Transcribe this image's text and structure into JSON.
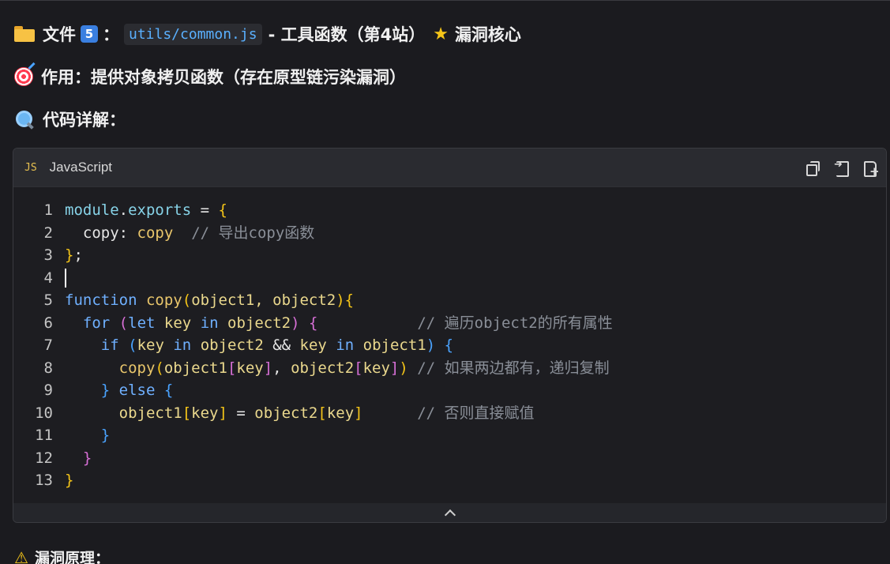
{
  "file_heading": {
    "prefix": "文件",
    "number": "5",
    "colon": "：",
    "path": "utils/common.js",
    "suffix": "- 工具函数（第4站）",
    "tag": "漏洞核心"
  },
  "purpose_heading": "作用：提供对象拷贝函数（存在原型链污染漏洞）",
  "explain_heading": "代码详解：",
  "code_block": {
    "lang_badge": "JS",
    "language": "JavaScript",
    "lines": [
      {
        "n": "1"
      },
      {
        "n": "2"
      },
      {
        "n": "3"
      },
      {
        "n": "4"
      },
      {
        "n": "5"
      },
      {
        "n": "6"
      },
      {
        "n": "7"
      },
      {
        "n": "8"
      },
      {
        "n": "9"
      },
      {
        "n": "10"
      },
      {
        "n": "11"
      },
      {
        "n": "12"
      },
      {
        "n": "13"
      }
    ],
    "tokens": {
      "module": "module",
      "exports": "exports",
      "copy": "copy",
      "function_kw": "function",
      "params": "object1, object2",
      "for_kw": "for",
      "let_kw": "let",
      "key": "key",
      "in_kw": "in",
      "object1": "object1",
      "object2": "object2",
      "if_kw": "if",
      "else_kw": "else",
      "comment2": "// 导出copy函数",
      "comment6": "// 遍历object2的所有属性",
      "comment8": "// 如果两边都有，递归复制",
      "comment10": "// 否则直接赋值"
    }
  },
  "principle_heading": "漏洞原理："
}
